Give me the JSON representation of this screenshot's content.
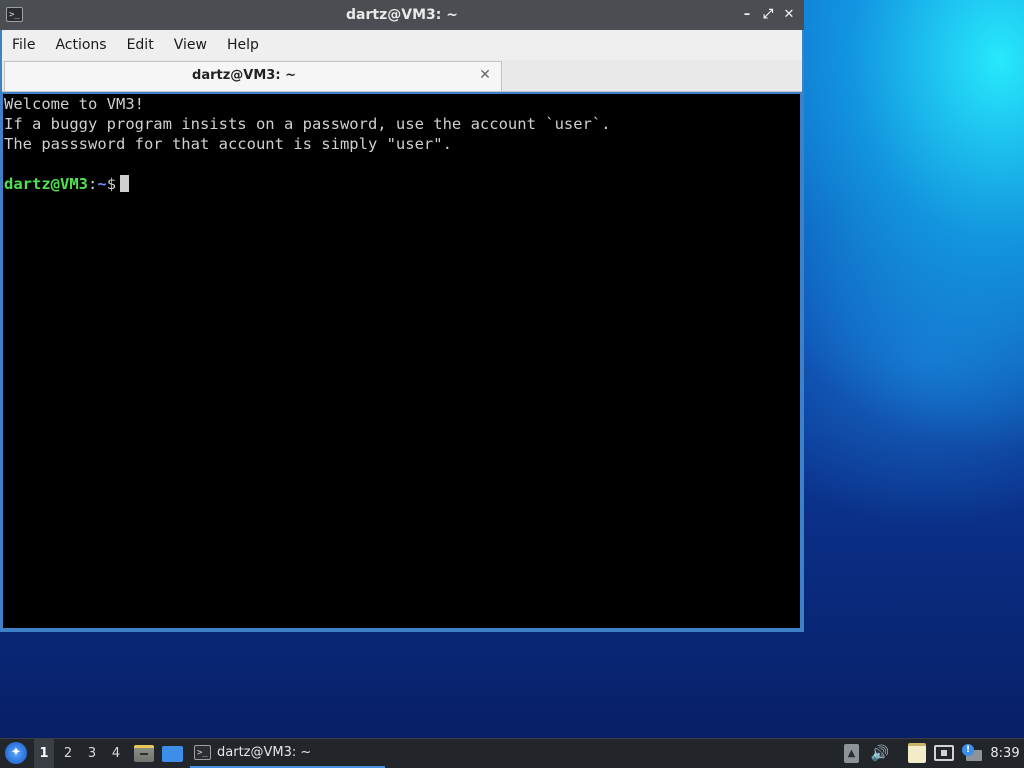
{
  "window": {
    "title": "dartz@VM3: ~",
    "controls": {
      "minimize": "–",
      "maximize": "⤢",
      "close": "✕"
    }
  },
  "menubar": {
    "items": [
      "File",
      "Actions",
      "Edit",
      "View",
      "Help"
    ]
  },
  "tabs": [
    {
      "label": "dartz@VM3: ~",
      "close": "✕",
      "active": true
    }
  ],
  "terminal": {
    "lines": [
      "Welcome to VM3!",
      "If a buggy program insists on a password, use the account `user`.",
      "The passsword for that account is simply \"user\"."
    ],
    "prompt": {
      "user_host": "dartz@VM3",
      "colon": ":",
      "path": "~",
      "symbol": "$"
    },
    "colors": {
      "background": "#000000",
      "text": "#cfcfcf",
      "prompt_user": "#4fe24f",
      "prompt_path": "#6d8dff"
    }
  },
  "taskbar": {
    "start_icon": "lxqt-menu-icon",
    "workspaces": [
      {
        "label": "1",
        "active": true
      },
      {
        "label": "2",
        "active": false
      },
      {
        "label": "3",
        "active": false
      },
      {
        "label": "4",
        "active": false
      }
    ],
    "launchers": [
      "file-manager-icon",
      "show-desktop-icon"
    ],
    "tasks": [
      {
        "label": "dartz@VM3: ~",
        "icon": "terminal-icon"
      }
    ],
    "tray": {
      "icons": [
        "updates-icon",
        "volume-icon",
        "clipboard-icon",
        "network-icon",
        "notification-icon"
      ],
      "updates_glyph": "▲",
      "volume_glyph": "🔊",
      "notify_glyph": "!"
    },
    "clock": "8:39"
  },
  "icons": {
    "terminal_glyph": ">_"
  },
  "colors": {
    "titlebar": "#4a4d52",
    "window_border": "#3f81c8",
    "taskbar": "#22262b",
    "accent": "#4a90e2"
  }
}
